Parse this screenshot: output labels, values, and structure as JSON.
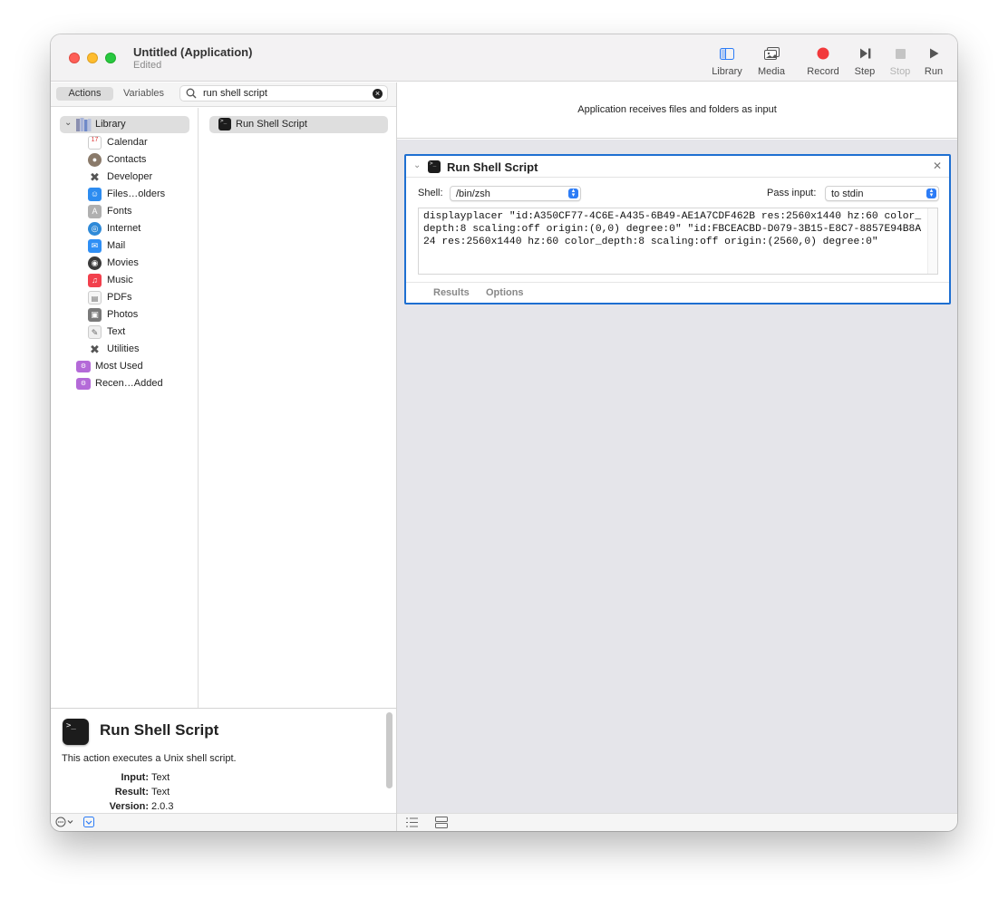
{
  "window": {
    "title": "Untitled (Application)",
    "subtitle": "Edited"
  },
  "toolbar": [
    {
      "label": "Library",
      "icon": "library-icon"
    },
    {
      "label": "Media",
      "icon": "media-icon"
    },
    {
      "label": "Record",
      "icon": "record-icon"
    },
    {
      "label": "Step",
      "icon": "step-icon"
    },
    {
      "label": "Stop",
      "icon": "stop-icon"
    },
    {
      "label": "Run",
      "icon": "run-icon"
    }
  ],
  "left_pane": {
    "tabs": {
      "actions": "Actions",
      "variables": "Variables"
    },
    "search": {
      "value": "run shell script"
    },
    "library": {
      "header": "Library",
      "items": [
        {
          "label": "Calendar",
          "icon": "calendar-icon",
          "color": "#ffffff"
        },
        {
          "label": "Contacts",
          "icon": "contacts-icon",
          "color": "#8a7a6a"
        },
        {
          "label": "Developer",
          "icon": "developer-icon",
          "color": "#555555"
        },
        {
          "label": "Files…olders",
          "icon": "finder-icon",
          "color": "#2d8cf0"
        },
        {
          "label": "Fonts",
          "icon": "fonts-icon",
          "color": "#9a9a9a"
        },
        {
          "label": "Internet",
          "icon": "internet-icon",
          "color": "#2f8ad8"
        },
        {
          "label": "Mail",
          "icon": "mail-icon",
          "color": "#2f8ff5"
        },
        {
          "label": "Movies",
          "icon": "movies-icon",
          "color": "#3a3a3a"
        },
        {
          "label": "Music",
          "icon": "music-icon",
          "color": "#f2404d"
        },
        {
          "label": "PDFs",
          "icon": "pdf-icon",
          "color": "#f5f5f5"
        },
        {
          "label": "Photos",
          "icon": "photos-icon",
          "color": "#7a7a7a"
        },
        {
          "label": "Text",
          "icon": "text-icon",
          "color": "#efefef"
        },
        {
          "label": "Utilities",
          "icon": "utilities-icon",
          "color": "#555555"
        }
      ],
      "smart_groups": [
        {
          "label": "Most Used",
          "icon": "folder-icon",
          "color": "#b46ad8"
        },
        {
          "label": "Recen…Added",
          "icon": "folder-icon",
          "color": "#b46ad8"
        }
      ]
    },
    "actions": [
      {
        "label": "Run Shell Script",
        "icon": "terminal-icon"
      }
    ],
    "description": {
      "title": "Run Shell Script",
      "text": "This action executes a Unix shell script.",
      "input_key": "Input:",
      "input_val": "Text",
      "result_key": "Result:",
      "result_val": "Text",
      "version_key": "Version:",
      "version_val": "2.0.3"
    }
  },
  "workflow": {
    "header_text": "Application receives files and folders as input",
    "action_card": {
      "title": "Run Shell Script",
      "shell_label": "Shell:",
      "shell_value": "/bin/zsh",
      "pass_input_label": "Pass input:",
      "pass_input_value": "to stdin",
      "script": "displayplacer \"id:A350CF77-4C6E-A435-6B49-AE1A7CDF462B res:2560x1440 hz:60 color_depth:8 scaling:off origin:(0,0) degree:0\" \"id:FBCEACBD-D079-3B15-E8C7-8857E94B8A24 res:2560x1440 hz:60 color_depth:8 scaling:off origin:(2560,0) degree:0\"",
      "tabs": [
        "Results",
        "Options"
      ]
    }
  },
  "colors": {
    "accent": "#1e6fd1",
    "record": "#f2393b"
  }
}
